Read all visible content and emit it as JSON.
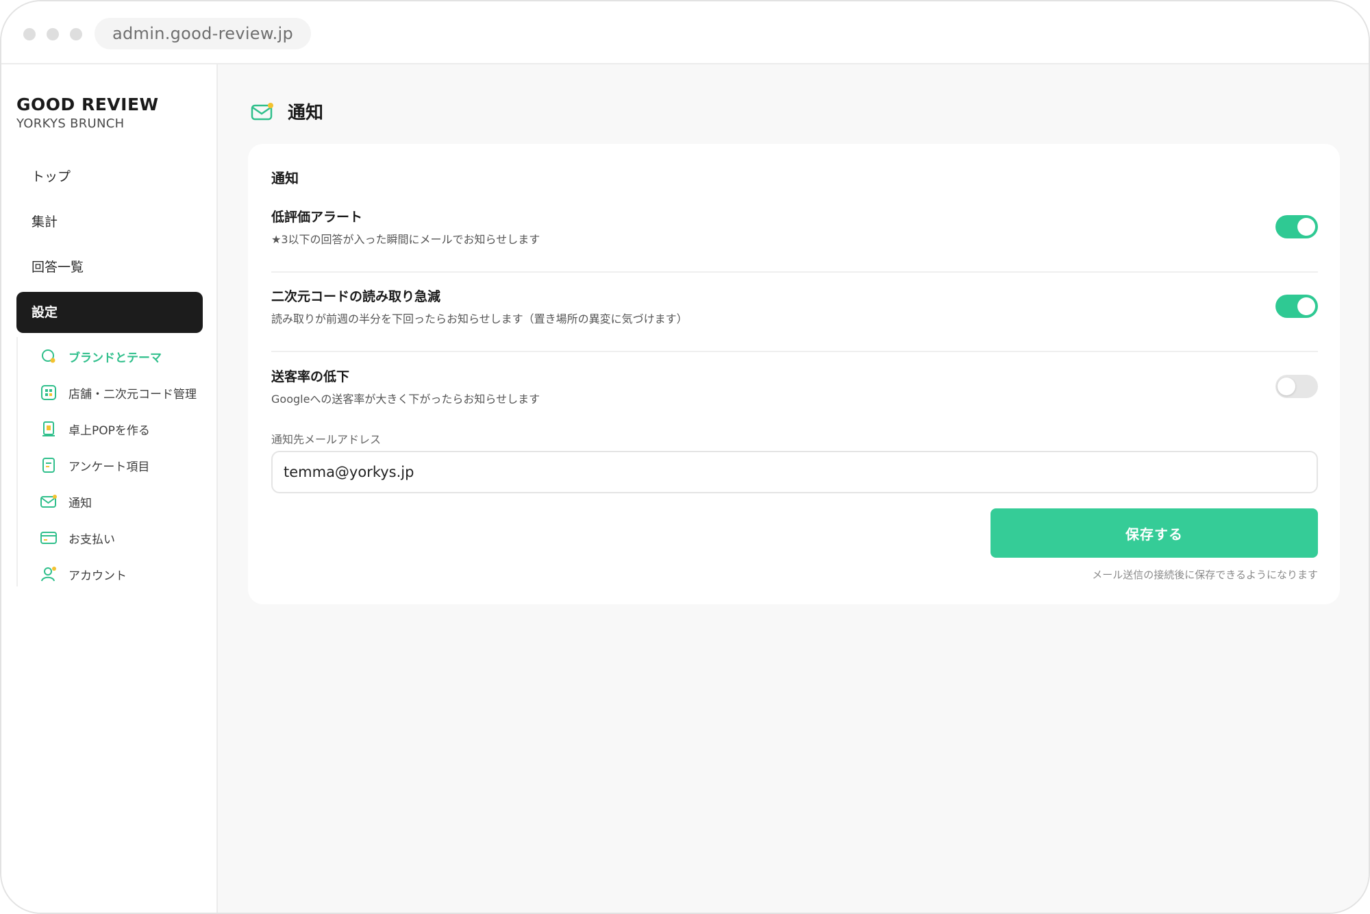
{
  "browser": {
    "url": "admin.good-review.jp"
  },
  "sidebar": {
    "brand": "GOOD REVIEW",
    "store": "YORKYS BRUNCH",
    "nav": [
      {
        "label": "トップ"
      },
      {
        "label": "集計"
      },
      {
        "label": "回答一覧"
      },
      {
        "label": "設定",
        "active": true
      }
    ],
    "sub_nav": [
      {
        "label": "ブランドとテーマ",
        "icon": "theme-icon",
        "current": true
      },
      {
        "label": "店舗・二次元コード管理",
        "icon": "qr-code-icon"
      },
      {
        "label": "卓上POPを作る",
        "icon": "pop-stand-icon"
      },
      {
        "label": "アンケート項目",
        "icon": "survey-form-icon"
      },
      {
        "label": "通知",
        "icon": "mail-icon"
      },
      {
        "label": "お支払い",
        "icon": "credit-card-icon"
      },
      {
        "label": "アカウント",
        "icon": "user-icon"
      }
    ]
  },
  "page": {
    "title": "通知",
    "title_icon": "mail-icon"
  },
  "card": {
    "title": "通知",
    "settings": [
      {
        "title": "低評価アラート",
        "desc": "★3以下の回答が入った瞬間にメールでお知らせします",
        "enabled": true
      },
      {
        "title": "二次元コードの読み取り急減",
        "desc": "読み取りが前週の半分を下回ったらお知らせします（置き場所の異変に気づけます）",
        "enabled": true
      },
      {
        "title": "送客率の低下",
        "desc": "Googleへの送客率が大きく下がったらお知らせします",
        "enabled": false
      }
    ],
    "email_label": "通知先メールアドレス",
    "email_value": "temma@yorkys.jp",
    "save_label": "保存する",
    "save_note": "メール送信の接続後に保存できるようになります"
  },
  "colors": {
    "accent": "#35cc97",
    "active_nav_bg": "#1c1c1c",
    "icon_dot": "#f2c230"
  }
}
